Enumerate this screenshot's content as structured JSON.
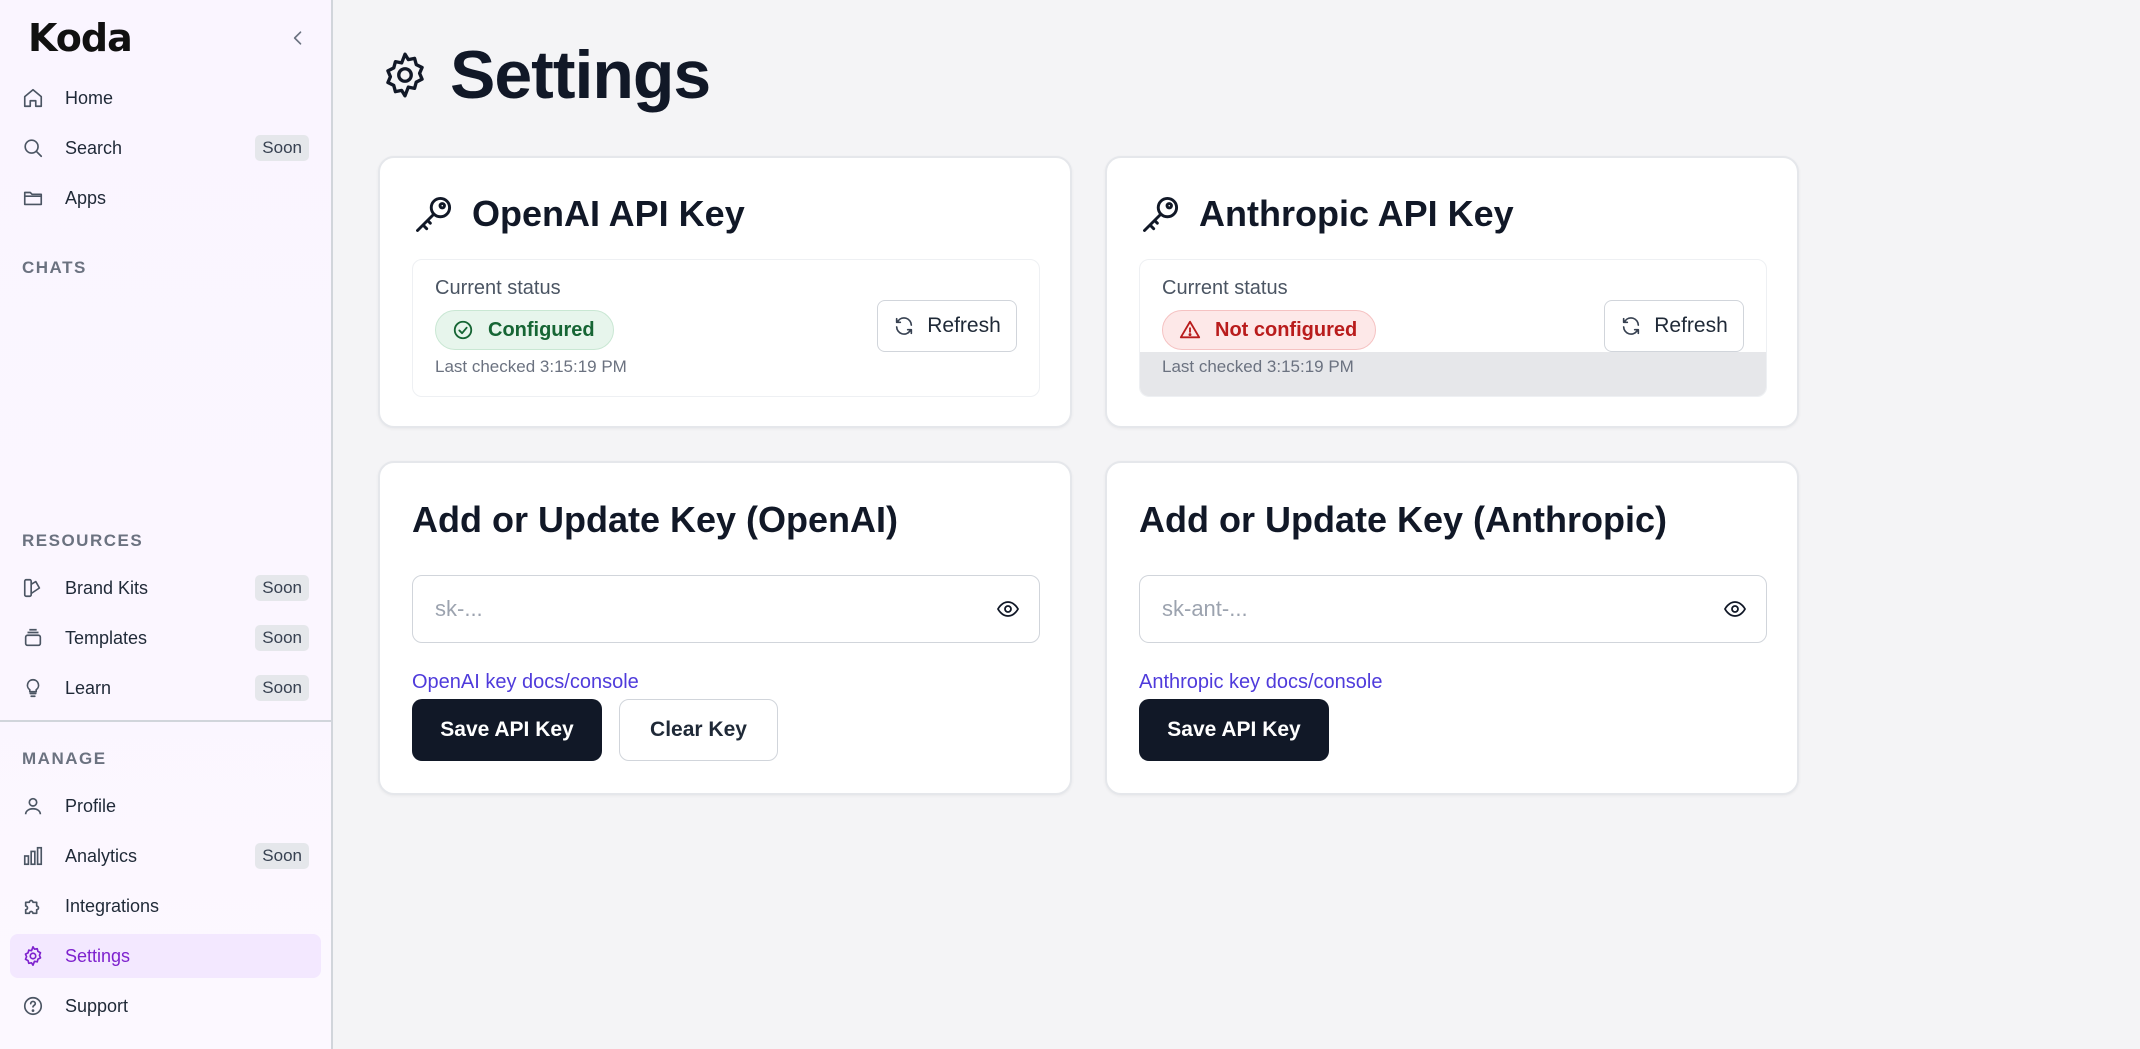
{
  "app": {
    "logo": "Koda"
  },
  "sidebar": {
    "nav": [
      {
        "label": "Home",
        "icon": "home-icon"
      },
      {
        "label": "Search",
        "icon": "search-icon",
        "badge": "Soon"
      },
      {
        "label": "Apps",
        "icon": "folder-icon"
      }
    ],
    "chats_label": "CHATS",
    "resources_label": "RESOURCES",
    "resources": [
      {
        "label": "Brand Kits",
        "icon": "palette-icon",
        "badge": "Soon"
      },
      {
        "label": "Templates",
        "icon": "layers-icon",
        "badge": "Soon"
      },
      {
        "label": "Learn",
        "icon": "lightbulb-icon",
        "badge": "Soon"
      }
    ],
    "manage_label": "MANAGE",
    "manage": [
      {
        "label": "Profile",
        "icon": "user-icon"
      },
      {
        "label": "Analytics",
        "icon": "bar-chart-icon",
        "badge": "Soon"
      },
      {
        "label": "Integrations",
        "icon": "puzzle-icon"
      },
      {
        "label": "Settings",
        "icon": "gear-icon",
        "active": true
      },
      {
        "label": "Support",
        "icon": "help-circle-icon"
      }
    ]
  },
  "page": {
    "title": "Settings"
  },
  "openai": {
    "title": "OpenAI API Key",
    "status_label": "Current status",
    "status": "Configured",
    "last_checked": "Last checked 3:15:19 PM",
    "refresh_label": "Refresh",
    "update_title": "Add or Update Key (OpenAI)",
    "placeholder": "sk-...",
    "docs_link": "OpenAI key docs/console",
    "save_label": "Save API Key",
    "clear_label": "Clear Key"
  },
  "anthropic": {
    "title": "Anthropic API Key",
    "status_label": "Current status",
    "status": "Not configured",
    "last_checked": "Last checked 3:15:19 PM",
    "refresh_label": "Refresh",
    "update_title": "Add or Update Key (Anthropic)",
    "placeholder": "sk-ant-...",
    "docs_link": "Anthropic key docs/console",
    "save_label": "Save API Key"
  },
  "colors": {
    "accent": "#7e22ce",
    "primary_button": "#111827",
    "link": "#4f3bdb",
    "success": "#166534",
    "danger": "#b91c1c"
  }
}
